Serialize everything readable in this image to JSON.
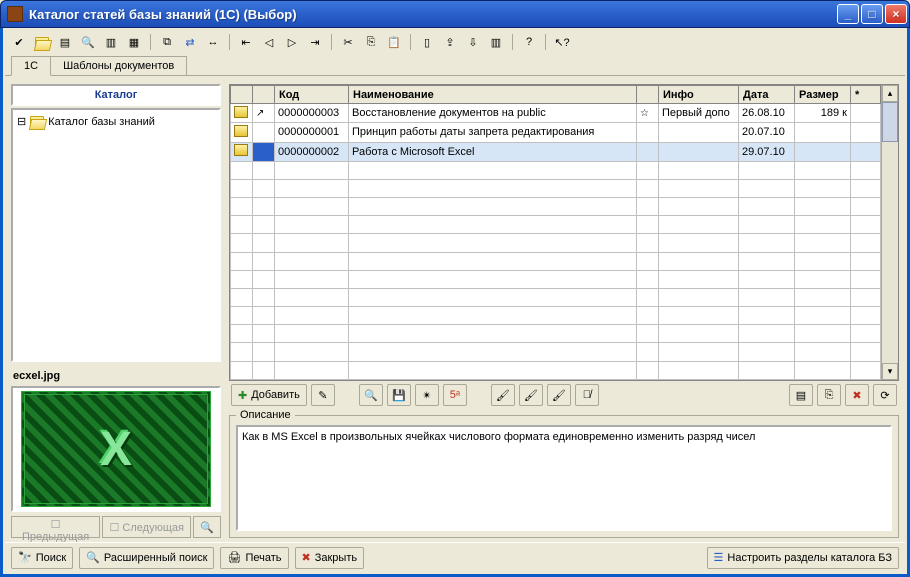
{
  "window": {
    "title": "Каталог статей базы знаний (1C) (Выбор)"
  },
  "tabs": [
    {
      "label": "1C",
      "active": true
    },
    {
      "label": "Шаблоны документов",
      "active": false
    }
  ],
  "catalog": {
    "header": "Каталог",
    "root_label": "Каталог базы знаний"
  },
  "grid": {
    "columns": {
      "code": "Код",
      "name": "Наименование",
      "info": "Инфо",
      "date": "Дата",
      "size": "Размер",
      "star": "*"
    },
    "rows": [
      {
        "code": "0000000003",
        "name": "Восстановление документов на public",
        "info": "Первый допо",
        "date": "26.08.10",
        "size": "189 к",
        "has_markers": true
      },
      {
        "code": "0000000001",
        "name": "Принцип работы даты запрета редактирования",
        "info": "",
        "date": "20.07.10",
        "size": "",
        "has_markers": false
      },
      {
        "code": "0000000002",
        "name": "Работа с Microsoft Excel",
        "info": "",
        "date": "29.07.10",
        "size": "",
        "has_markers": false
      }
    ],
    "selected_index": 2,
    "empty_rows": 12
  },
  "preview": {
    "filename": "ecxel.jpg",
    "glyph": "X",
    "prev_label": "Предыдущая",
    "next_label": "Следующая"
  },
  "mid": {
    "add_label": "Добавить"
  },
  "desc": {
    "legend": "Описание",
    "text": "Как в MS Excel в произвольных ячейках числового формата единовременно изменить разряд чисел"
  },
  "bottom": {
    "search_label": "Поиск",
    "adv_search_label": "Расширенный поиск",
    "print_label": "Печать",
    "close_label": "Закрыть",
    "configure_label": "Настроить разделы каталога БЗ"
  },
  "icons": {
    "minimize": "_",
    "maximize": "□",
    "close": "×"
  }
}
